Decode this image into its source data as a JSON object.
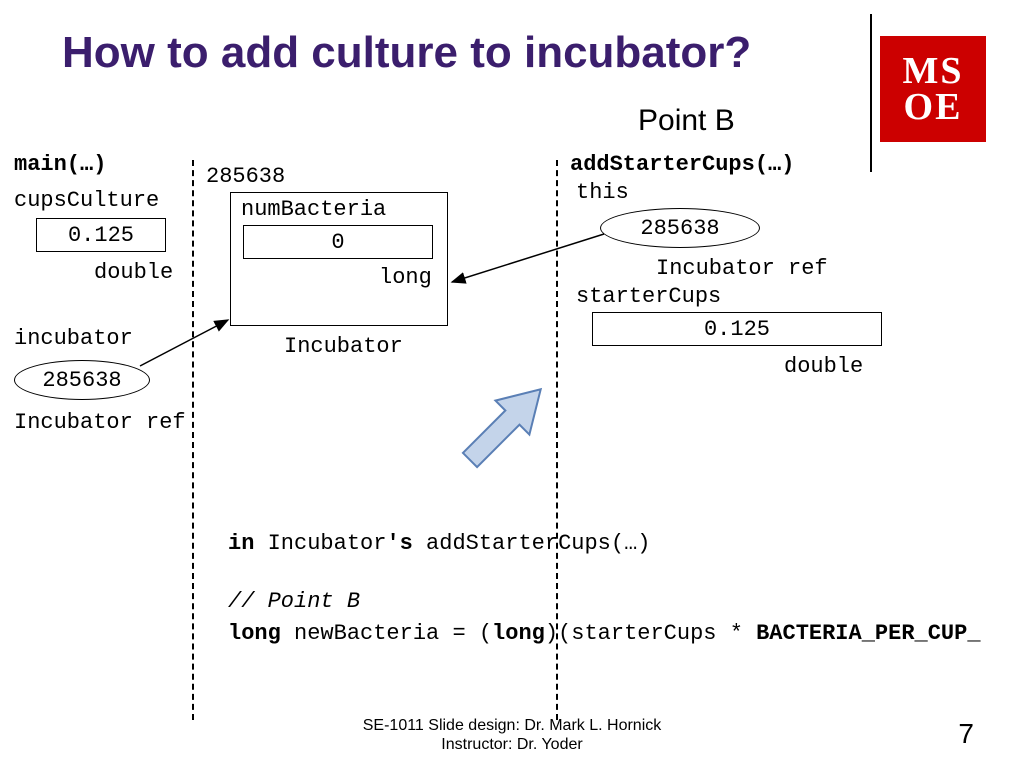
{
  "title": "How to add culture to incubator?",
  "point_label": "Point B",
  "logo_text": "MS\nOE",
  "columns": {
    "main": "main(…)",
    "addStarter": "addStarterCups(…)"
  },
  "main_vars": {
    "cupsCulture": {
      "label": "cupsCulture",
      "value": "0.125",
      "type": "double"
    },
    "incubator": {
      "label": "incubator",
      "value": "285638",
      "type": "Incubator ref"
    }
  },
  "heap": {
    "address": "285638",
    "numBacteria_label": "numBacteria",
    "numBacteria_value": "0",
    "numBacteria_type": "long",
    "class_label": "Incubator"
  },
  "right_vars": {
    "this": {
      "label": "this",
      "value": "285638",
      "type": "Incubator ref"
    },
    "starterCups": {
      "label": "starterCups",
      "value": "0.125",
      "type": "double"
    }
  },
  "code": {
    "line1_pre": "in ",
    "line1_obj": "Incubator",
    "line1_poss": "'s ",
    "line1_method": "addStarterCups(…)",
    "comment": "// Point B",
    "line3_kw1": "long",
    "line3_mid1": " newBacteria = (",
    "line3_kw2": "long",
    "line3_mid2": ")(starterCups * ",
    "line3_const": "BACTERIA_PER_CUP_",
    "line3_end": ""
  },
  "footer1": "SE-1011 Slide design: Dr. Mark L. Hornick",
  "footer2": "Instructor: Dr. Yoder",
  "slide_number": "7"
}
